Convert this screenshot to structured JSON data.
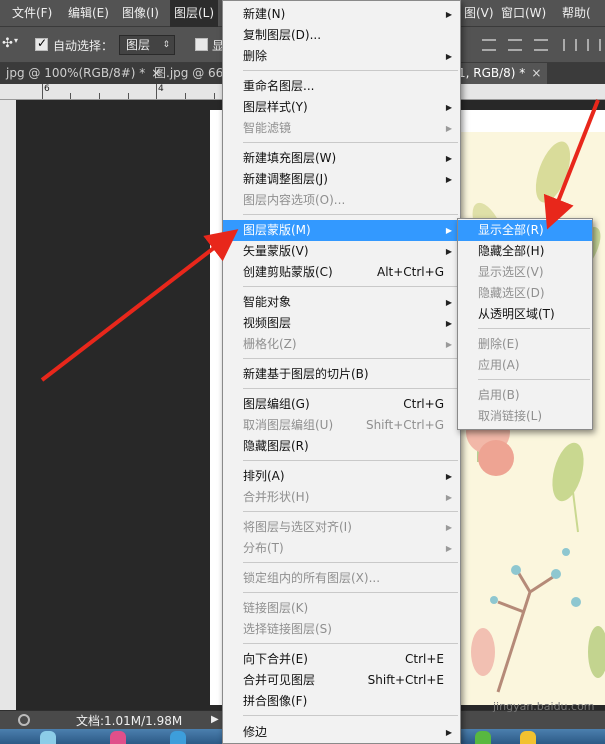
{
  "menubar": {
    "file": "文件(F)",
    "edit": "编辑(E)",
    "image": "图像(I)",
    "layer": "图层(L)",
    "view_partial": "图(V)",
    "window": "窗口(W)",
    "help": "帮助("
  },
  "options": {
    "auto_select_label": "自动选择：",
    "auto_select_value": "图层",
    "show_partial": "显"
  },
  "tabs": [
    {
      "label": "jpg @ 100%(RGB/8#) *",
      "close": "×"
    },
    {
      "label": "图.jpg @ 66."
    },
    {
      "label": "1, RGB/8) *",
      "close": "×"
    }
  ],
  "ruler": {
    "marks": [
      "6",
      "4"
    ]
  },
  "status": {
    "doc_size": "文档:1.01M/1.98M"
  },
  "watermark": "jingyan.baidu.com",
  "layer_menu": {
    "items": [
      {
        "label": "新建(N)",
        "sub": true
      },
      {
        "label": "复制图层(D)..."
      },
      {
        "label": "删除",
        "sub": true
      },
      {
        "label": "重命名图层..."
      },
      {
        "label": "图层样式(Y)",
        "sub": true
      },
      {
        "label": "智能滤镜",
        "sub": true,
        "disabled": true
      },
      {
        "label": "新建填充图层(W)",
        "sub": true
      },
      {
        "label": "新建调整图层(J)",
        "sub": true
      },
      {
        "label": "图层内容选项(O)...",
        "disabled": true
      },
      {
        "label": "图层蒙版(M)",
        "sub": true,
        "highlighted": true
      },
      {
        "label": "矢量蒙版(V)",
        "sub": true
      },
      {
        "label": "创建剪贴蒙版(C)",
        "shortcut": "Alt+Ctrl+G"
      },
      {
        "label": "智能对象",
        "sub": true
      },
      {
        "label": "视频图层",
        "sub": true
      },
      {
        "label": "栅格化(Z)",
        "sub": true,
        "disabled": true
      },
      {
        "label": "新建基于图层的切片(B)"
      },
      {
        "label": "图层编组(G)",
        "shortcut": "Ctrl+G"
      },
      {
        "label": "取消图层编组(U)",
        "shortcut": "Shift+Ctrl+G",
        "disabled": true
      },
      {
        "label": "隐藏图层(R)"
      },
      {
        "label": "排列(A)",
        "sub": true
      },
      {
        "label": "合并形状(H)",
        "sub": true,
        "disabled": true
      },
      {
        "label": "将图层与选区对齐(I)",
        "sub": true,
        "disabled": true
      },
      {
        "label": "分布(T)",
        "sub": true,
        "disabled": true
      },
      {
        "label": "锁定组内的所有图层(X)...",
        "disabled": true
      },
      {
        "label": "链接图层(K)",
        "disabled": true
      },
      {
        "label": "选择链接图层(S)",
        "disabled": true
      },
      {
        "label": "向下合并(E)",
        "shortcut": "Ctrl+E"
      },
      {
        "label": "合并可见图层",
        "shortcut": "Shift+Ctrl+E"
      },
      {
        "label": "拼合图像(F)"
      },
      {
        "label": "修边",
        "sub": true
      }
    ]
  },
  "mask_submenu": {
    "items": [
      {
        "label": "显示全部(R)",
        "highlighted": true
      },
      {
        "label": "隐藏全部(H)"
      },
      {
        "label": "显示选区(V)",
        "disabled": true
      },
      {
        "label": "隐藏选区(D)",
        "disabled": true
      },
      {
        "label": "从透明区域(T)"
      },
      {
        "label": "删除(E)",
        "disabled": true
      },
      {
        "label": "应用(A)",
        "disabled": true
      },
      {
        "label": "启用(B)",
        "disabled": true
      },
      {
        "label": "取消链接(L)",
        "disabled": true
      }
    ]
  },
  "colors": {
    "highlight": "#3399ff",
    "arrow": "#e8271b",
    "menu_bg": "#f2f2f2",
    "ui_dark": "#535353"
  },
  "icons": {
    "submenu": "submenu-arrow-icon",
    "checkbox": "checkbox-icon",
    "move": "move-tool-icon"
  }
}
